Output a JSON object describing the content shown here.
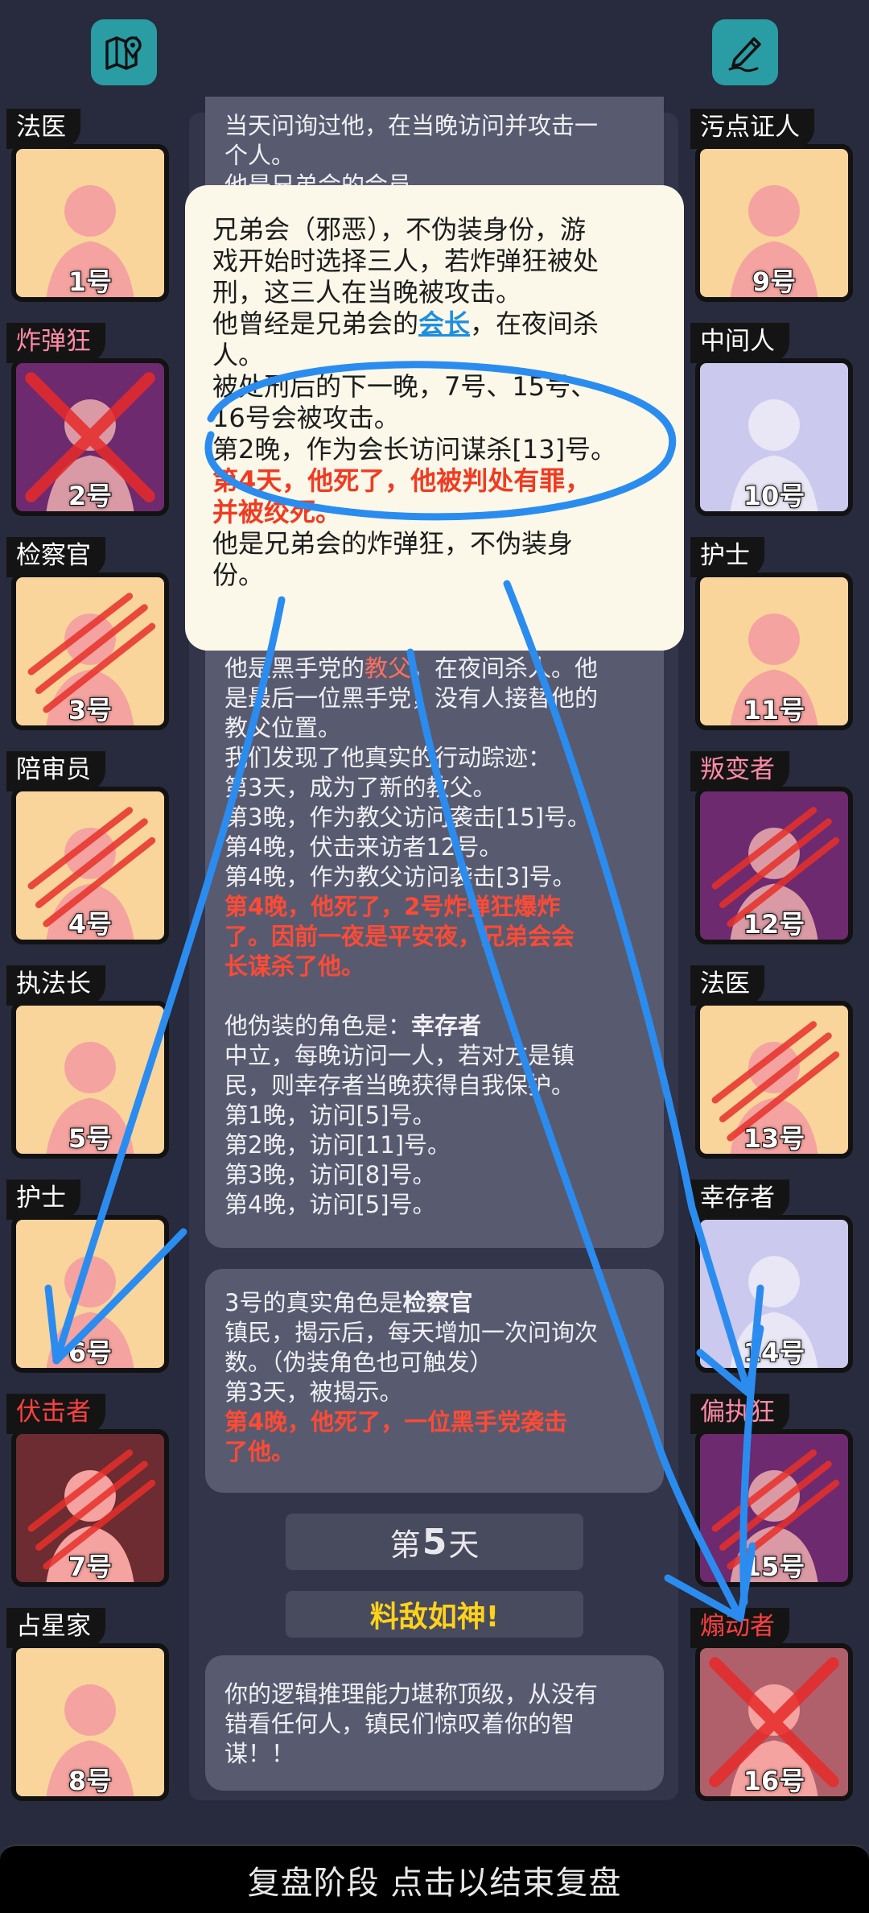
{
  "top_buttons": {
    "left_icon": "map-pin-icon",
    "right_icon": "pen-edit-icon"
  },
  "players_left": [
    {
      "role": "法医",
      "number": "1号",
      "style": "peach",
      "tag": "normal",
      "dead": false,
      "mark": "none"
    },
    {
      "role": "炸弹狂",
      "number": "2号",
      "style": "purple",
      "tag": "pink",
      "dead": true,
      "mark": "cross"
    },
    {
      "role": "检察官",
      "number": "3号",
      "style": "peach",
      "tag": "normal",
      "dead": true,
      "mark": "claw"
    },
    {
      "role": "陪审员",
      "number": "4号",
      "style": "peach",
      "tag": "normal",
      "dead": true,
      "mark": "claw"
    },
    {
      "role": "执法长",
      "number": "5号",
      "style": "peach",
      "tag": "normal",
      "dead": false,
      "mark": "none"
    },
    {
      "role": "护士",
      "number": "6号",
      "style": "peach",
      "tag": "normal",
      "dead": false,
      "mark": "none"
    },
    {
      "role": "伏击者",
      "number": "7号",
      "style": "brown",
      "tag": "red",
      "dead": true,
      "mark": "claw"
    },
    {
      "role": "占星家",
      "number": "8号",
      "style": "peach",
      "tag": "normal",
      "dead": false,
      "mark": "none"
    }
  ],
  "players_right": [
    {
      "role": "污点证人",
      "number": "9号",
      "style": "peach",
      "tag": "normal",
      "dead": false,
      "mark": "none"
    },
    {
      "role": "中间人",
      "number": "10号",
      "style": "lav",
      "tag": "normal",
      "dead": false,
      "mark": "none"
    },
    {
      "role": "护士",
      "number": "11号",
      "style": "peach",
      "tag": "normal",
      "dead": false,
      "mark": "none"
    },
    {
      "role": "叛变者",
      "number": "12号",
      "style": "purple",
      "tag": "pink",
      "dead": true,
      "mark": "claw"
    },
    {
      "role": "法医",
      "number": "13号",
      "style": "peach",
      "tag": "normal",
      "dead": true,
      "mark": "claw"
    },
    {
      "role": "幸存者",
      "number": "14号",
      "style": "lav",
      "tag": "normal",
      "dead": false,
      "mark": "none"
    },
    {
      "role": "偏执狂",
      "number": "15号",
      "style": "purple",
      "tag": "pink",
      "dead": true,
      "mark": "claw"
    },
    {
      "role": "煽动者",
      "number": "16号",
      "style": "rose",
      "tag": "red",
      "dead": true,
      "mark": "cross"
    }
  ],
  "card_top": {
    "line1": "当天问询过他，在当晚访问并攻击一",
    "line2": "个人。",
    "line3": "他是兄弟会的会员"
  },
  "popup": {
    "l1": "兄弟会（邪恶），不伪装身份，游",
    "l2": "戏开始时选择三人，若炸弹狂被处",
    "l3": "刑，这三人在当晚被攻击。",
    "l4a": "他曾经是兄弟会的",
    "l4b": "会长",
    "l4c": "，在夜间杀",
    "l5": "人。",
    "l6": "被处刑后的下一晚，7号、15号、",
    "l7": "16号会被攻击。",
    "l8": "第2晚，作为会长访问谋杀[13]号。",
    "l9": "第4天，他死了，他被判处有罪，",
    "l10": "并被绞死。",
    "l11": "他是兄弟会的炸弹狂，不伪装身",
    "l12": "份。"
  },
  "card_godfather": {
    "l1a": "他是黑手党的",
    "l1b": "教父",
    "l1c": "，在夜间杀人。他",
    "l2": "是最后一位黑手党，没有人接替他的",
    "l3": "教父位置。",
    "l4": "我们发现了他真实的行动踪迹：",
    "l5": "第3天，成为了新的教父。",
    "l6": "第3晚，作为教父访问袭击[15]号。",
    "l7": "第4晚，伏击来访者12号。",
    "l8": "第4晚，作为教父访问袭击[3]号。",
    "l9": "第4晚，他死了，2号炸弹狂爆炸",
    "l10": "了。因前一夜是平安夜，兄弟会会",
    "l11": "长谋杀了他。",
    "l12a": "他伪装的角色是：",
    "l12b": "幸存者",
    "l13": "中立，每晚访问一人，若对方是镇",
    "l14": "民，则幸存者当晚获得自我保护。",
    "l15": "第1晚，访问[5]号。",
    "l16": "第2晚，访问[11]号。",
    "l17": "第3晚，访问[8]号。",
    "l18": "第4晚，访问[5]号。"
  },
  "card_prosecutor": {
    "l1a": "3号的真实角色是",
    "l1b": "检察官",
    "l2": "镇民，揭示后，每天增加一次问询次",
    "l3": "数。（伪装角色也可触发）",
    "l4": "第3天，被揭示。",
    "l5": "第4晚，他死了，一位黑手党袭击",
    "l6": "了他。"
  },
  "day_pill": {
    "prefix": "第",
    "num": "5",
    "suffix": "天"
  },
  "result_pill": {
    "text": "料敌如神!"
  },
  "card_final": {
    "l1": "你的逻辑推理能力堪称顶级，从没有",
    "l2": "错看任何人，镇民们惊叹着你的智",
    "l3": "谋！！"
  },
  "footer": {
    "text": "复盘阶段 点击以结束复盘"
  },
  "colors": {
    "background": "#282a3e",
    "card": "#585b70",
    "accent_teal": "#2a9ca4",
    "death_red": "#ff4a35",
    "annotation_blue": "#2b8cf0"
  }
}
